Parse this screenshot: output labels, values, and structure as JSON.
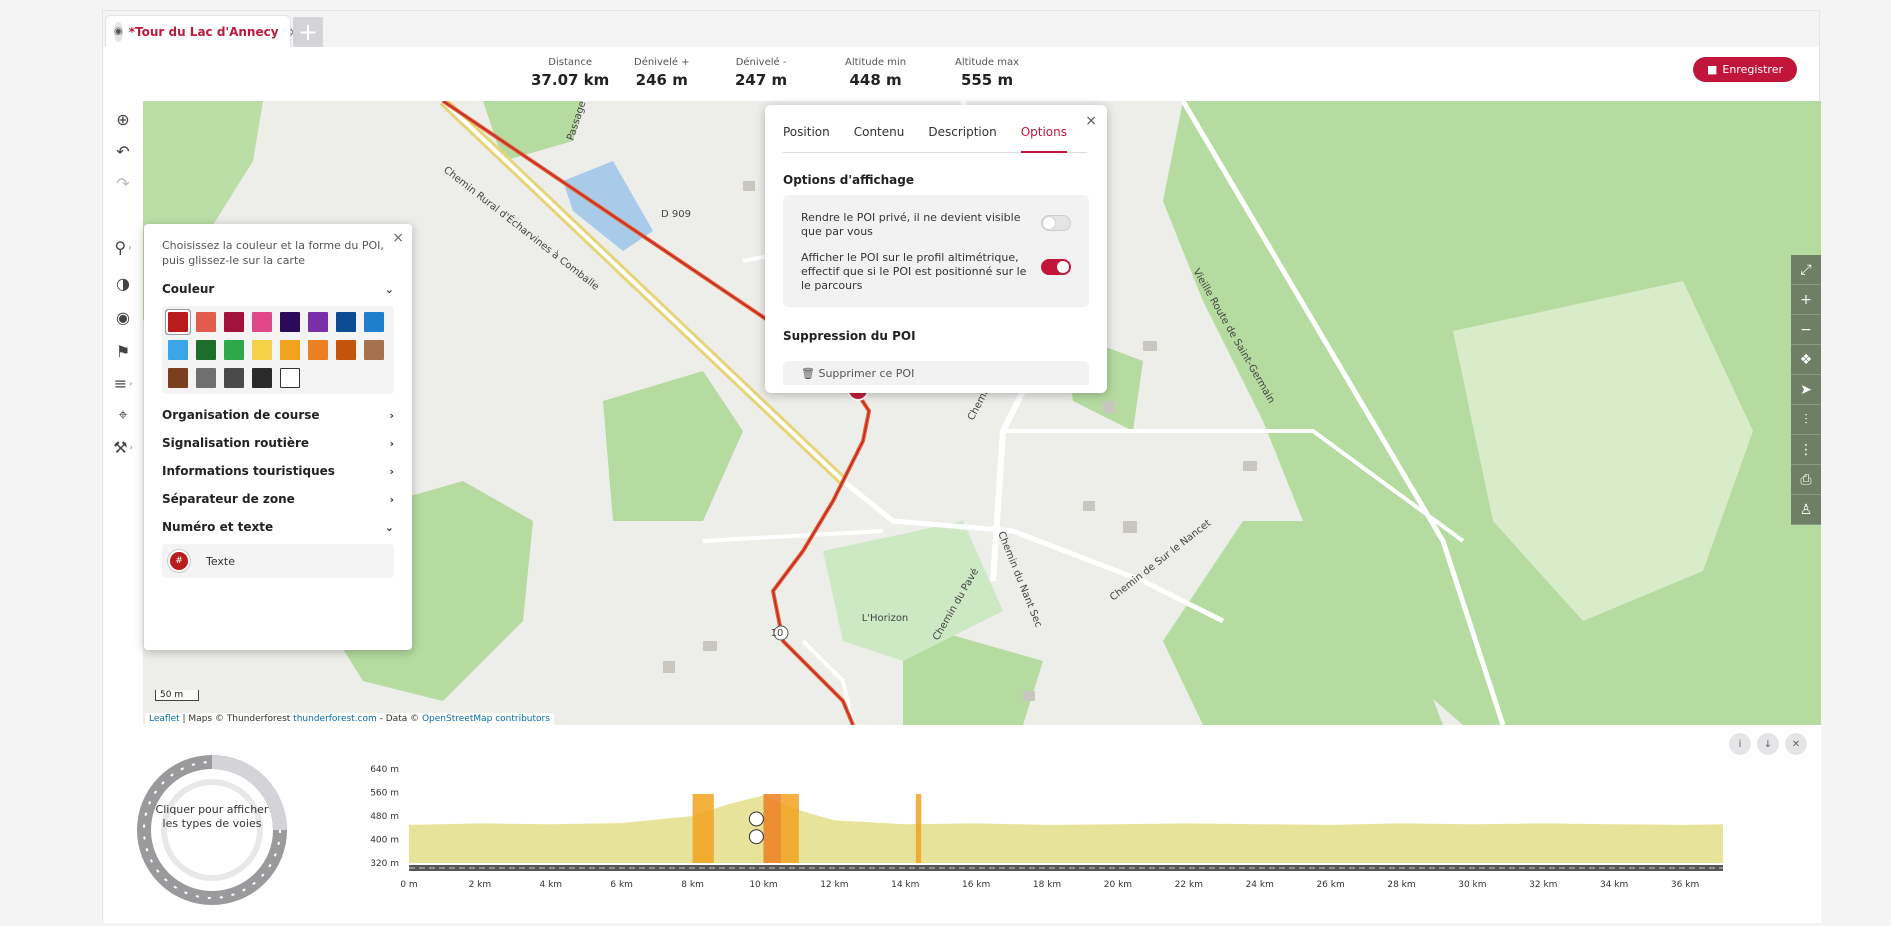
{
  "tab": {
    "title": "*Tour du Lac d'Annecy",
    "close": "×",
    "add": "+"
  },
  "stats": [
    {
      "label": "Distance",
      "value": "37.07 km"
    },
    {
      "label": "Dénivelé +",
      "value": "246 m"
    },
    {
      "label": "Dénivelé -",
      "value": "247 m"
    },
    {
      "label": "Altitude min",
      "value": "448 m"
    },
    {
      "label": "Altitude max",
      "value": "555 m"
    }
  ],
  "save_button": "Enregistrer",
  "poi_panel": {
    "hint": "Choisissez la couleur et la forme du POI, puis glissez-le sur la carte",
    "close": "×",
    "couleur": "Couleur",
    "colors": [
      "#b91c1c",
      "#e35b4a",
      "#a3123c",
      "#e0488a",
      "#2c0a5a",
      "#7a2ea8",
      "#0c4c94",
      "#1e7fce",
      "#3aa6e8",
      "#1d6e2a",
      "#2ea84a",
      "#f7d04a",
      "#f2a31e",
      "#ec7f22",
      "#c4540a",
      "#a6714f",
      "#7b3f1e",
      "#6f6f6f",
      "#4a4a4a",
      "#2a2a2a",
      "#ffffff"
    ],
    "sections": [
      "Organisation de course",
      "Signalisation routière",
      "Informations touristiques",
      "Séparateur de zone"
    ],
    "numero": "Numéro et texte",
    "badge": "#",
    "texte": "Texte"
  },
  "options": {
    "tabs": [
      "Position",
      "Contenu",
      "Description",
      "Options"
    ],
    "display_heading": "Options d'affichage",
    "private_label": "Rendre le POI privé, il ne devient visible que par vous",
    "profile_label": "Afficher le POI sur le profil altimétrique, effectif que si le POI est positionné sur le le parcours",
    "delete_heading": "Suppression du POI",
    "delete_btn": "Supprimer ce POI",
    "close": "×"
  },
  "map": {
    "attribution_leaflet": "Leaflet",
    "attribution_mid": " | Maps © Thunderforest ",
    "attribution_tf": "thunderforest.com",
    "attribution_data": " - Data © ",
    "attribution_osm": "OpenStreetMap contributors",
    "scale": "50 m",
    "labels": [
      "Chemin Rural d'Écharvines à Comballe",
      "Chemin de Sur le Nancet",
      "Chemin des Granges",
      "Vieille Route de Saint-Germain",
      "Chemin du Nant Sec",
      "Chemin du Pavé",
      "L'Horizon",
      "Passage du Lanfon",
      "D 909",
      "10"
    ]
  },
  "profile": {
    "donut_text": "Cliquer pour afficher les types de voies",
    "y_ticks": [
      "640 m",
      "560 m",
      "480 m",
      "400 m",
      "320 m"
    ],
    "x_ticks": [
      "0 m",
      "2 km",
      "4 km",
      "6 km",
      "8 km",
      "10 km",
      "12 km",
      "14 km",
      "16 km",
      "18 km",
      "20 km",
      "22 km",
      "24 km",
      "26 km",
      "28 km",
      "30 km",
      "32 km",
      "34 km",
      "36 km"
    ]
  },
  "chart_data": {
    "type": "area",
    "x": [
      0,
      2,
      4,
      6,
      8,
      9,
      10,
      11,
      12,
      14,
      16,
      18,
      20,
      22,
      24,
      26,
      28,
      30,
      32,
      34,
      36,
      37.07
    ],
    "y": [
      450,
      455,
      452,
      456,
      480,
      520,
      550,
      500,
      465,
      452,
      455,
      450,
      452,
      455,
      452,
      450,
      455,
      452,
      455,
      452,
      450,
      452
    ],
    "ylim": [
      320,
      640
    ],
    "xlim": [
      0,
      37.07
    ],
    "fill_color": "#e8e39a"
  }
}
